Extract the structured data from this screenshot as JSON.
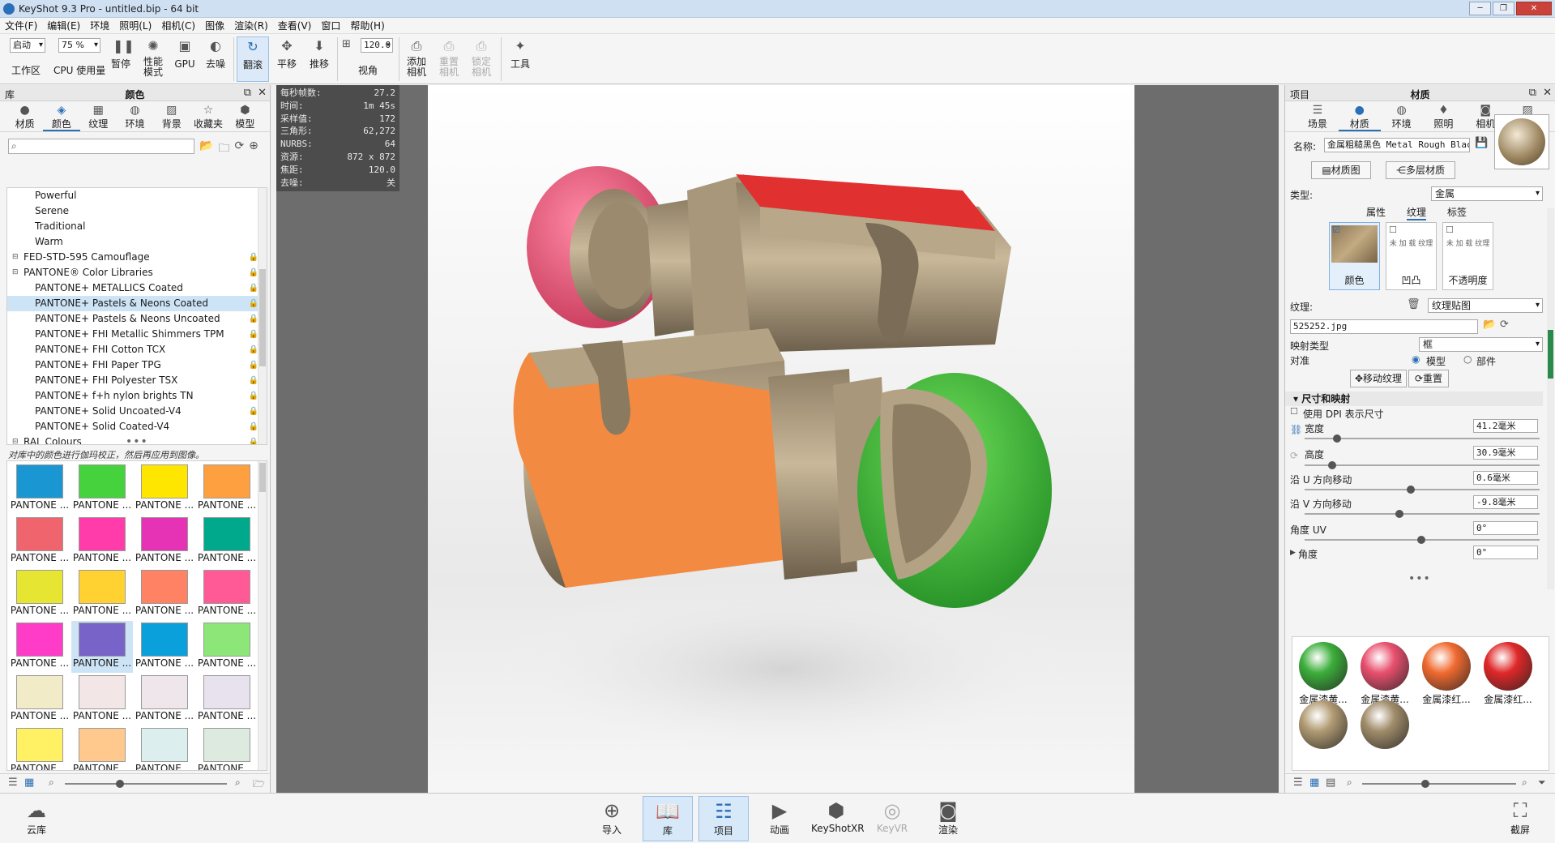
{
  "window": {
    "title": "KeyShot 9.3 Pro  - untitled.bip  - 64 bit",
    "min": "─",
    "max": "❐",
    "close": "✕"
  },
  "menu": [
    "文件(F)",
    "编辑(E)",
    "环境",
    "照明(L)",
    "相机(C)",
    "图像",
    "渲染(R)",
    "查看(V)",
    "窗口",
    "帮助(H)"
  ],
  "toolbar": {
    "mode_select": "启动",
    "zoom_select": "75 %",
    "workspace": "工作区",
    "cpu_usage": "CPU 使用量",
    "pause": "暂停",
    "performance_mode": "性能\n模式",
    "gpu": "GPU",
    "denoise": "去噪",
    "tumble": "翻滚",
    "pan": "平移",
    "dolly": "推移",
    "fov_value": "120.0",
    "fov": "视角",
    "add_camera": "添加\n相机",
    "reset_camera": "重置\n相机",
    "lock_camera": "锁定\n相机",
    "tools": "工具"
  },
  "library": {
    "header_left": "库",
    "header_title": "颜色",
    "tabs": [
      "材质",
      "颜色",
      "纹理",
      "环境",
      "背景",
      "收藏夹",
      "模型"
    ],
    "active_tab": "颜色",
    "tree": [
      {
        "label": "Powerful",
        "level": 2,
        "lock": false
      },
      {
        "label": "Serene",
        "level": 2,
        "lock": false
      },
      {
        "label": "Traditional",
        "level": 2,
        "lock": false
      },
      {
        "label": "Warm",
        "level": 2,
        "lock": false
      },
      {
        "label": "FED-STD-595 Camouflage",
        "level": 1,
        "lock": true
      },
      {
        "label": "PANTONE® Color Libraries",
        "level": 1,
        "lock": true
      },
      {
        "label": "PANTONE+ METALLICS Coated",
        "level": 2,
        "lock": true
      },
      {
        "label": "PANTONE+ Pastels & Neons Coated",
        "level": 2,
        "lock": true,
        "selected": true
      },
      {
        "label": "PANTONE+ Pastels & Neons Uncoated",
        "level": 2,
        "lock": true
      },
      {
        "label": "PANTONE+ FHI Metallic Shimmers TPM",
        "level": 2,
        "lock": true
      },
      {
        "label": "PANTONE+ FHI Cotton TCX",
        "level": 2,
        "lock": true
      },
      {
        "label": "PANTONE+ FHI Paper TPG",
        "level": 2,
        "lock": true
      },
      {
        "label": "PANTONE+ FHI Polyester TSX",
        "level": 2,
        "lock": true
      },
      {
        "label": "PANTONE+ f+h nylon brights TN",
        "level": 2,
        "lock": true
      },
      {
        "label": "PANTONE+ Solid Uncoated-V4",
        "level": 2,
        "lock": true
      },
      {
        "label": "PANTONE+ Solid Coated-V4",
        "level": 2,
        "lock": true
      },
      {
        "label": "RAL Colours",
        "level": 1,
        "lock": true
      }
    ],
    "notice": "对库中的颜色进行伽玛校正，然后再应用到图像。",
    "swatch_label": "PANTONE ...",
    "swatches": [
      "#1a96d2",
      "#46d23c",
      "#ffe600",
      "#ffa040",
      "#f0646e",
      "#ff3caa",
      "#e632b4",
      "#00a88c",
      "#e6e632",
      "#ffd232",
      "#ff8264",
      "#ff5a96",
      "#ff3cc8",
      "#7864c8",
      "#0aa0dc",
      "#8ce678",
      "#f2ebc8",
      "#f2e6e6",
      "#efe6ec",
      "#e8e2ee",
      "#fff064",
      "#ffc88c",
      "#dcefee",
      "#dceae0"
    ],
    "selected_swatch": 13
  },
  "hud": [
    {
      "k": "每秒帧数:",
      "v": "27.2"
    },
    {
      "k": "时间:",
      "v": "1m 45s"
    },
    {
      "k": "采样值:",
      "v": "172"
    },
    {
      "k": "三角形:",
      "v": "62,272"
    },
    {
      "k": "NURBS:",
      "v": "64"
    },
    {
      "k": "资源:",
      "v": "872 x 872"
    },
    {
      "k": "焦距:",
      "v": "120.0"
    },
    {
      "k": "去噪:",
      "v": "关"
    }
  ],
  "project": {
    "header_left": "项目",
    "header_title": "材质",
    "tabs": [
      "场景",
      "材质",
      "环境",
      "照明",
      "相机",
      "图像"
    ],
    "active_tab": "材质",
    "name_label": "名称:",
    "name_value": "金属粗糙黑色 Metal Rough Black",
    "material_graph": "材质图",
    "multi_material": "多层材质",
    "type_label": "类型:",
    "type_value": "金属",
    "subtabs": [
      "属性",
      "纹理",
      "标签"
    ],
    "active_subtab": "纹理",
    "texture_cards": [
      {
        "cap": "颜色",
        "thumb": ""
      },
      {
        "cap": "凹凸",
        "thumb": "未 加 载 纹理"
      },
      {
        "cap": "不透明度",
        "thumb": "未 加 载 纹理"
      }
    ],
    "texture_label": "纹理:",
    "texture_type": "纹理贴图",
    "texture_file": "525252.jpg",
    "mapping_label": "映射类型",
    "mapping_value": "框",
    "align_label": "对准",
    "align_model": "模型",
    "align_part": "部件",
    "move_texture": "移动纹理",
    "reset": "重置",
    "size_section": "尺寸和映射",
    "use_dpi": "使用 DPI 表示尺寸",
    "width_label": "宽度",
    "width_value": "41.2毫米",
    "height_label": "高度",
    "height_value": "30.9毫米",
    "u_label": "沿 U 方向移动",
    "u_value": "0.6毫米",
    "v_label": "沿 V 方向移动",
    "v_value": "-9.8毫米",
    "uv_label": "角度 UV",
    "uv_value": "0°",
    "angle_label": "角度",
    "angle_value": "0°",
    "materials": [
      {
        "cap": "金属漆黄...",
        "color": "#3cae3a"
      },
      {
        "cap": "金属漆黄...",
        "color": "#e8506e"
      },
      {
        "cap": "金属漆红...",
        "color": "#f06a30"
      },
      {
        "cap": "金属漆红...",
        "color": "#e02828"
      },
      {
        "cap": "",
        "color": "#b09a72"
      },
      {
        "cap": "",
        "color": "#a08c6a"
      }
    ]
  },
  "dock": {
    "cloud": "云库",
    "import": "导入",
    "library": "库",
    "project": "项目",
    "animation": "动画",
    "keyshotxr": "KeyShotXR",
    "keyvr": "KeyVR",
    "render": "渲染",
    "screenshot": "截屏"
  }
}
